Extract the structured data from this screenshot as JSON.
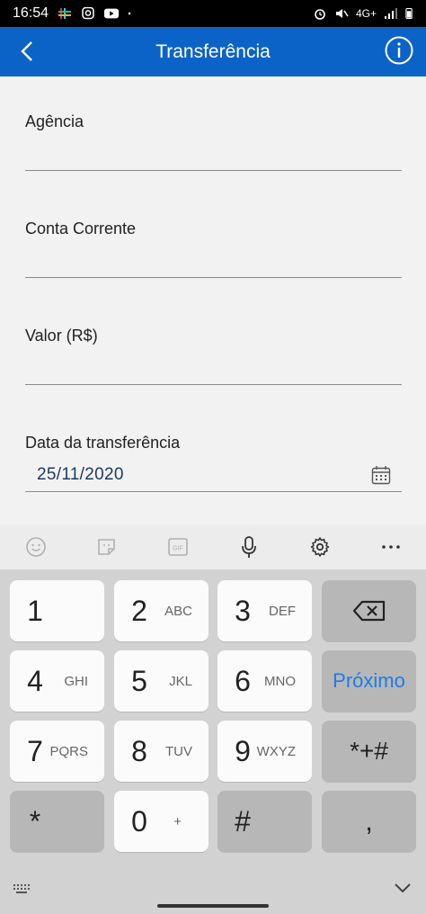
{
  "status_bar": {
    "time": "16:54",
    "network": "4G+"
  },
  "app_bar": {
    "title": "Transferência"
  },
  "form": {
    "agencia_label": "Agência",
    "conta_label": "Conta Corrente",
    "valor_label": "Valor (R$)",
    "data_label": "Data da transferência",
    "data_value": "25/11/2020"
  },
  "keyboard": {
    "keys": [
      {
        "num": "1",
        "sub": ""
      },
      {
        "num": "2",
        "sub": "ABC"
      },
      {
        "num": "3",
        "sub": "DEF"
      },
      {
        "num": "4",
        "sub": "GHI"
      },
      {
        "num": "5",
        "sub": "JKL"
      },
      {
        "num": "6",
        "sub": "MNO"
      },
      {
        "num": "7",
        "sub": "PQRS"
      },
      {
        "num": "8",
        "sub": "TUV"
      },
      {
        "num": "9",
        "sub": "WXYZ"
      },
      {
        "num": "0",
        "sub": "+"
      }
    ],
    "next_label": "Próximo",
    "symbols_label": "*+#",
    "star_label": "*",
    "hash_label": "#",
    "comma_label": ",",
    "gif_label": "GIF"
  },
  "colors": {
    "app_bar": "#0b63c8",
    "accent": "#1a7ee8"
  }
}
